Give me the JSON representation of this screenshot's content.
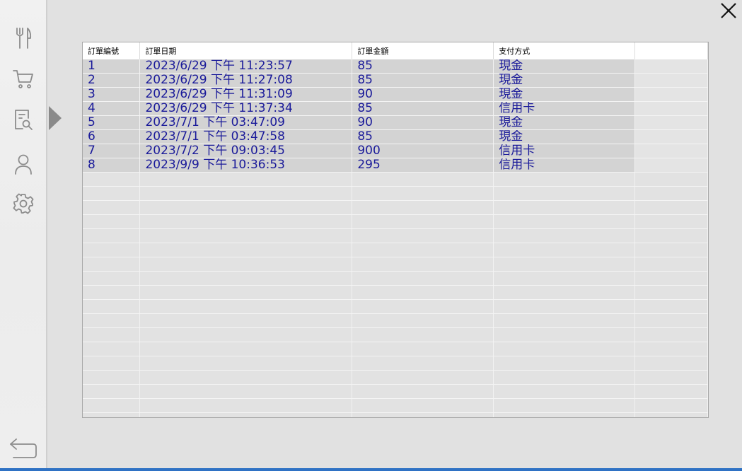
{
  "sidebar": {
    "items": [
      {
        "icon": "fork-knife-icon"
      },
      {
        "icon": "cart-icon"
      },
      {
        "icon": "receipt-search-icon"
      },
      {
        "icon": "user-icon"
      },
      {
        "icon": "gear-icon"
      }
    ],
    "back_icon": "back-arrow-icon"
  },
  "window": {
    "close_icon": "close-icon"
  },
  "orders_table": {
    "columns": [
      "訂單編號",
      "訂單日期",
      "訂單金額",
      "支付方式"
    ],
    "rows": [
      {
        "id": "1",
        "date": "2023/6/29 下午 11:23:57",
        "amount": "85",
        "payment": "現金"
      },
      {
        "id": "2",
        "date": "2023/6/29 下午 11:27:08",
        "amount": "85",
        "payment": "現金"
      },
      {
        "id": "3",
        "date": "2023/6/29 下午 11:31:09",
        "amount": "90",
        "payment": "現金"
      },
      {
        "id": "4",
        "date": "2023/6/29 下午 11:37:34",
        "amount": "85",
        "payment": "信用卡"
      },
      {
        "id": "5",
        "date": "2023/7/1 下午 03:47:09",
        "amount": "90",
        "payment": "現金"
      },
      {
        "id": "6",
        "date": "2023/7/1 下午 03:47:58",
        "amount": "85",
        "payment": "現金"
      },
      {
        "id": "7",
        "date": "2023/7/2 下午 09:03:45",
        "amount": "900",
        "payment": "信用卡"
      },
      {
        "id": "8",
        "date": "2023/9/9 下午 10:36:53",
        "amount": "295",
        "payment": "信用卡"
      }
    ]
  },
  "colors": {
    "cell_text": "#1a1a9a",
    "filled_row": "#d3d3d3",
    "accent": "#2f72c4"
  }
}
